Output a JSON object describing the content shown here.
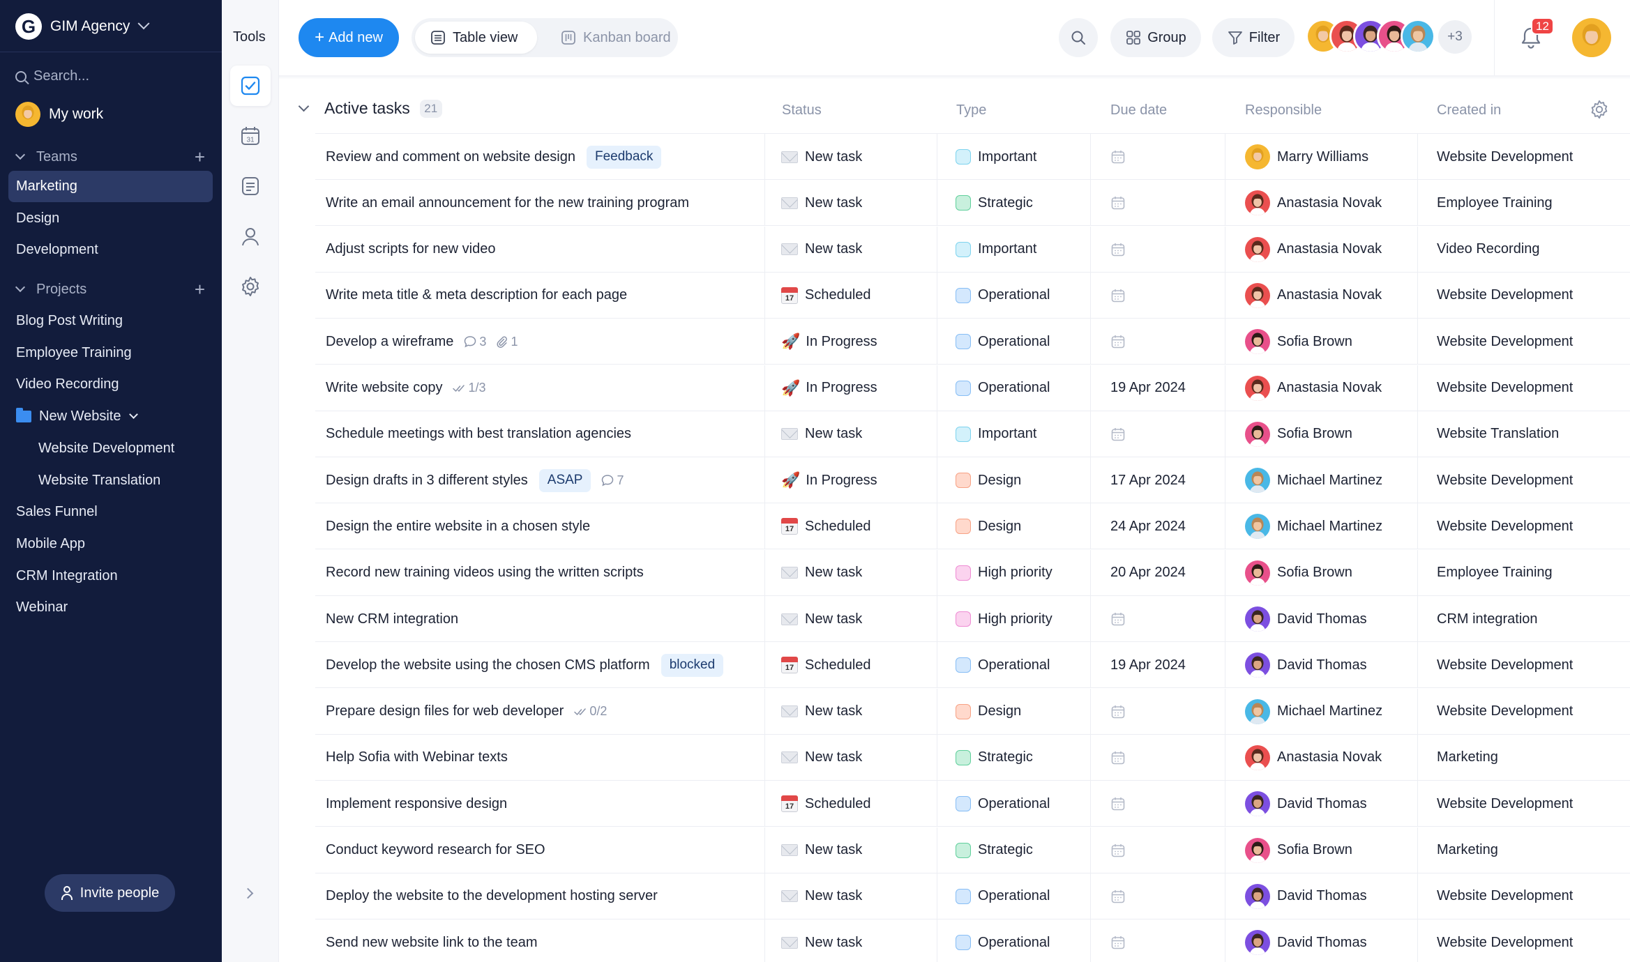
{
  "sidebar": {
    "brand_logo": "G",
    "brand_name": "GIM Agency",
    "search_placeholder": "Search...",
    "my_work": "My work",
    "teams_label": "Teams",
    "teams": [
      "Marketing",
      "Design",
      "Development"
    ],
    "active_team": "Marketing",
    "projects_label": "Projects",
    "projects": [
      {
        "label": "Blog Post Writing"
      },
      {
        "label": "Employee Training"
      },
      {
        "label": "Video Recording"
      },
      {
        "label": "New Website",
        "folder": true
      },
      {
        "label": "Website Development",
        "sub": true
      },
      {
        "label": "Website Translation",
        "sub": true
      },
      {
        "label": "Sales Funnel"
      },
      {
        "label": "Mobile App"
      },
      {
        "label": "CRM Integration"
      },
      {
        "label": "Webinar"
      }
    ],
    "invite_label": "Invite people"
  },
  "tools": {
    "title": "Tools",
    "icons": [
      "tasks-icon",
      "calendar-icon",
      "notes-icon",
      "contacts-icon",
      "settings-icon"
    ],
    "calendar_day": "31"
  },
  "toolbar": {
    "add_label": "Add new",
    "views": [
      "Table view",
      "Kanban board"
    ],
    "active_view": "Table view",
    "group_label": "Group",
    "filter_label": "Filter",
    "extra_members": "+3",
    "notification_count": "12"
  },
  "table": {
    "group_title": "Active tasks",
    "group_count": "21",
    "columns": [
      "Status",
      "Type",
      "Due date",
      "Responsible",
      "Created in"
    ],
    "rows": [
      {
        "title": "Review and comment on website design",
        "tag": "Feedback",
        "status": "New task",
        "type": "Important",
        "due": "",
        "responsible": "Marry Williams",
        "created": "Website Development"
      },
      {
        "title": "Write an email announcement for the new training program",
        "status": "New task",
        "type": "Strategic",
        "due": "",
        "responsible": "Anastasia Novak",
        "created": "Employee Training"
      },
      {
        "title": "Adjust scripts for new video",
        "status": "New task",
        "type": "Important",
        "due": "",
        "responsible": "Anastasia Novak",
        "created": "Video Recording"
      },
      {
        "title": "Write meta title & meta description for each page",
        "status": "Scheduled",
        "type": "Operational",
        "due": "",
        "responsible": "Anastasia Novak",
        "created": "Website Development"
      },
      {
        "title": "Develop a wireframe",
        "comments": "3",
        "attachments": "1",
        "status": "In Progress",
        "type": "Operational",
        "due": "",
        "responsible": "Sofia Brown",
        "created": "Website Development"
      },
      {
        "title": "Write website copy",
        "checklist": "1/3",
        "status": "In Progress",
        "type": "Operational",
        "due": "19 Apr 2024",
        "responsible": "Anastasia Novak",
        "created": "Website Development"
      },
      {
        "title": "Schedule meetings with best translation agencies",
        "status": "New task",
        "type": "Important",
        "due": "",
        "responsible": "Sofia Brown",
        "created": "Website Translation"
      },
      {
        "title": "Design drafts in 3 different styles",
        "tag": "ASAP",
        "comments": "7",
        "status": "In Progress",
        "type": "Design",
        "due": "17 Apr 2024",
        "responsible": "Michael Martinez",
        "created": "Website Development"
      },
      {
        "title": "Design the entire website in a chosen style",
        "status": "Scheduled",
        "type": "Design",
        "due": "24 Apr 2024",
        "responsible": "Michael Martinez",
        "created": "Website Development"
      },
      {
        "title": "Record new training videos using the written scripts",
        "status": "New task",
        "type": "High priority",
        "due": "20 Apr 2024",
        "responsible": "Sofia Brown",
        "created": "Employee Training"
      },
      {
        "title": "New CRM integration",
        "status": "New task",
        "type": "High priority",
        "due": "",
        "responsible": "David Thomas",
        "created": "CRM integration"
      },
      {
        "title": "Develop the website using the chosen CMS platform",
        "tag": "blocked",
        "status": "Scheduled",
        "type": "Operational",
        "due": "19 Apr 2024",
        "responsible": "David Thomas",
        "created": "Website Development"
      },
      {
        "title": "Prepare design files for web developer",
        "checklist": "0/2",
        "status": "New task",
        "type": "Design",
        "due": "",
        "responsible": "Michael Martinez",
        "created": "Website Development"
      },
      {
        "title": "Help Sofia with Webinar texts",
        "status": "New task",
        "type": "Strategic",
        "due": "",
        "responsible": "Anastasia Novak",
        "created": "Marketing"
      },
      {
        "title": "Implement responsive design",
        "status": "Scheduled",
        "type": "Operational",
        "due": "",
        "responsible": "David Thomas",
        "created": "Website Development"
      },
      {
        "title": "Conduct keyword research for SEO",
        "status": "New task",
        "type": "Strategic",
        "due": "",
        "responsible": "Sofia Brown",
        "created": "Marketing"
      },
      {
        "title": "Deploy the website to the development hosting server",
        "status": "New task",
        "type": "Operational",
        "due": "",
        "responsible": "David Thomas",
        "created": "Website Development"
      },
      {
        "title": "Send new website link to the team",
        "status": "New task",
        "type": "Operational",
        "due": "",
        "responsible": "David Thomas",
        "created": "Website Development"
      }
    ]
  },
  "type_colors": {
    "Important": {
      "fill": "#d3f1fb",
      "border": "#7dd3ee"
    },
    "Strategic": {
      "fill": "#c8f0dd",
      "border": "#5fcf9b"
    },
    "Operational": {
      "fill": "#d4e8fd",
      "border": "#86bdf5"
    },
    "Design": {
      "fill": "#ffd9cc",
      "border": "#f7a184"
    },
    "High priority": {
      "fill": "#fbd3ef",
      "border": "#ee8bd3"
    }
  },
  "status_icons": {
    "New task": "envelope-icon",
    "Scheduled": "calendar-icon",
    "In Progress": "rocket-icon"
  },
  "people": {
    "Marry Williams": {
      "bg": "#f5b731",
      "hair": "#e2a020",
      "skin": "#f3c9a5",
      "shirt": "#f5b731"
    },
    "Anastasia Novak": {
      "bg": "#ea4f4f",
      "hair": "#5a2a1c",
      "skin": "#f0c4a8",
      "shirt": "#ffffff"
    },
    "Sofia Brown": {
      "bg": "#e8508a",
      "hair": "#2d1b17",
      "skin": "#e9b998",
      "shirt": "#ffffff"
    },
    "Michael Martinez": {
      "bg": "#49b8e6",
      "hair": "#b98656",
      "skin": "#efc6a2",
      "shirt": "#dfe9f2"
    },
    "David Thomas": {
      "bg": "#7c4fe0",
      "hair": "#3a2620",
      "skin": "#dba583",
      "shirt": "#ffffff"
    }
  },
  "header_members": [
    "Marry Williams",
    "Anastasia Novak",
    "David Thomas",
    "Sofia Brown",
    "Michael Martinez"
  ],
  "current_user": "Marry Williams"
}
